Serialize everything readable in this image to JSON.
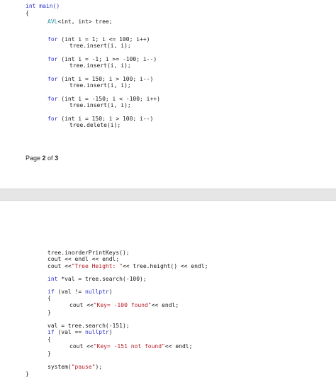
{
  "top_page": {
    "code": {
      "l1": "int main()",
      "l2": "{",
      "l3_type": "AVL",
      "l3_rest": "<int, int> tree;",
      "l4_kw": "for",
      "l4_rest": " (int i = 1; i <= 100; i++)",
      "l5": "tree.insert(i, i);",
      "l6_kw": "for",
      "l6_rest": " (int i = -1; i >= -100; i--)",
      "l7": "tree.insert(i, i);",
      "l8_kw": "for",
      "l8_rest": " (int i = 150; i > 100; i--)",
      "l9": "tree.insert(i, i);",
      "l10_kw": "for",
      "l10_rest": " (int i = -150; i < -100; i++)",
      "l11": "tree.insert(i, i);",
      "l12_kw": "for",
      "l12_rest": " (int i = 150; i > 100; i--)",
      "l13": "tree.delete(i);"
    },
    "page_label_prefix": "Page ",
    "page_num": "2",
    "page_of": " of ",
    "page_total": "3"
  },
  "bottom_page": {
    "code": {
      "b1": "tree.inorderPrintKeys();",
      "b2": "cout << endl << endl;",
      "b3_pre": "cout <<",
      "b3_str": "\"Tree Height: \"",
      "b3_post": "<< tree.height() << endl;",
      "b4_kw": "int",
      "b4_rest": " *val = tree.search(-100);",
      "b5_kw": "if",
      "b5_mid": " (val != ",
      "b5_kw2": "nullptr",
      "b5_end": ")",
      "b6": "{",
      "b7_pre": "cout <<",
      "b7_str": "\"Key= -100 found\"",
      "b7_post": "<< endl;",
      "b8": "}",
      "b9": "val = tree.search(-151);",
      "b10_kw": "if",
      "b10_mid": " (val == ",
      "b10_kw2": "nullptr",
      "b10_end": ")",
      "b11": "{",
      "b12_pre": "cout <<",
      "b12_str": "\"Key= -151 not found\"",
      "b12_post": "<< endl;",
      "b13": "}",
      "b14_pre": "system(",
      "b14_str": "\"pause\"",
      "b14_post": ");",
      "b15": "}"
    }
  }
}
